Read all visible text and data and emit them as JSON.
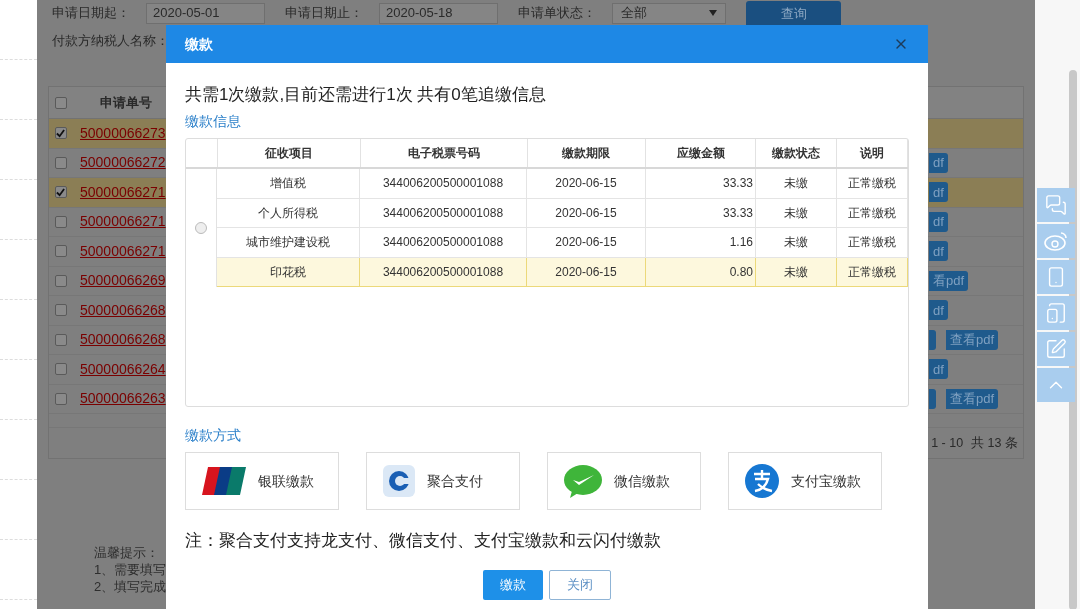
{
  "filters": [
    {
      "kind": "input",
      "label": "申请日期起：",
      "value": "2020-05-01"
    },
    {
      "kind": "input",
      "label": "申请日期止：",
      "value": "2020-05-18"
    },
    {
      "kind": "select",
      "label": "申请单状态：",
      "value": "全部"
    }
  ],
  "query_button": "查询",
  "payer_label": "付款方纳税人名称：",
  "list": {
    "header_checked": false,
    "column": "申请单号",
    "rows": [
      {
        "number": "50000066273",
        "checked": true,
        "actions": []
      },
      {
        "number": "50000066272",
        "checked": false,
        "actions": [
          "df"
        ]
      },
      {
        "number": "50000066271",
        "checked": true,
        "actions": [
          "df"
        ]
      },
      {
        "number": "50000066271",
        "checked": false,
        "actions": [
          "df"
        ]
      },
      {
        "number": "50000066271",
        "checked": false,
        "actions": [
          "df"
        ]
      },
      {
        "number": "50000066269",
        "checked": false,
        "actions": [
          "看pdf"
        ]
      },
      {
        "number": "50000066268",
        "checked": false,
        "actions": [
          "df"
        ]
      },
      {
        "number": "50000066268",
        "checked": false,
        "edge_button": true,
        "actions": [
          "查看pdf"
        ]
      },
      {
        "number": "50000066264",
        "checked": false,
        "actions": [
          "df"
        ]
      },
      {
        "number": "50000066263",
        "checked": false,
        "edge_button": true,
        "actions": [
          "查看pdf"
        ]
      }
    ],
    "range": "1 - 10",
    "total": "共 13 条"
  },
  "tips": [
    "温馨提示：",
    "1、需要填写",
    "2、填写完成"
  ],
  "dialog": {
    "title": "缴款",
    "summary": "共需1次缴款,目前还需进行1次 共有0笔追缴信息",
    "info_heading": "缴款信息",
    "columns": [
      "征收项目",
      "电子税票号码",
      "缴款期限",
      "应缴金额",
      "缴款状态",
      "说明"
    ],
    "radio_selected": false,
    "rows": [
      {
        "selected": false,
        "cells": [
          "增值税",
          "344006200500001088",
          "2020-06-15",
          "33.33",
          "未缴",
          "正常缴税"
        ]
      },
      {
        "selected": false,
        "cells": [
          "个人所得税",
          "344006200500001088",
          "2020-06-15",
          "33.33",
          "未缴",
          "正常缴税"
        ]
      },
      {
        "selected": false,
        "cells": [
          "城市维护建设税",
          "344006200500001088",
          "2020-06-15",
          "1.16",
          "未缴",
          "正常缴税"
        ]
      },
      {
        "selected": true,
        "cells": [
          "印花税",
          "344006200500001088",
          "2020-06-15",
          "0.80",
          "未缴",
          "正常缴税"
        ]
      }
    ],
    "method_heading": "缴款方式",
    "methods": [
      {
        "kind": "unionpay",
        "label": "银联缴款"
      },
      {
        "kind": "aggregate",
        "label": "聚合支付"
      },
      {
        "kind": "wechat",
        "label": "微信缴款"
      },
      {
        "kind": "alipay",
        "label": "支付宝缴款"
      }
    ],
    "note": "注：聚合支付支持龙支付、微信支付、支付宝缴款和云闪付缴款",
    "buttons": [
      {
        "kind": "primary",
        "label": "缴款"
      },
      {
        "kind": "secondary",
        "label": "关闭"
      }
    ]
  }
}
